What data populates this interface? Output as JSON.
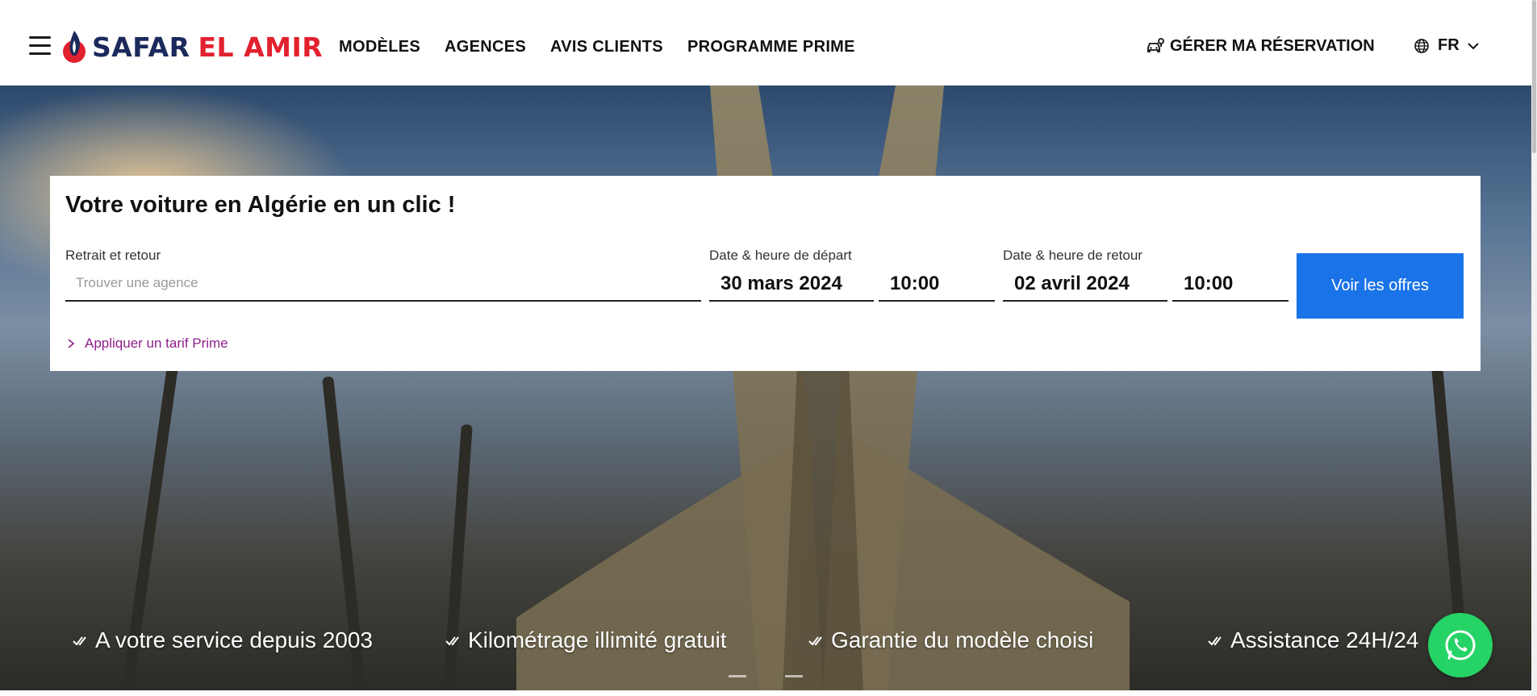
{
  "header": {
    "brand_part1": "SAFAR",
    "brand_part2": "EL AMIR",
    "nav": [
      "MODÈLES",
      "AGENCES",
      "AVIS CLIENTS",
      "PROGRAMME PRIME"
    ],
    "manage_label": "GÉRER MA RÉSERVATION",
    "lang_label": "FR",
    "icons": {
      "menu": "hamburger-icon",
      "logo": "flame-logo-icon",
      "manage": "car-key-icon",
      "lang": "globe-icon",
      "dropdown": "chevron-down-icon"
    }
  },
  "booking": {
    "title": "Votre voiture en Algérie en un clic !",
    "pickup_label": "Retrait et retour",
    "pickup_placeholder": "Trouver une agence",
    "depart_label": "Date & heure de départ",
    "depart_date": "30 mars 2024",
    "depart_time": "10:00",
    "return_label": "Date & heure de retour",
    "return_date": "02 avril 2024",
    "return_time": "10:00",
    "cta_label": "Voir les offres",
    "prime_link": "Appliquer un tarif Prime"
  },
  "features": [
    "A votre service depuis 2003",
    "Kilométrage illimité gratuit",
    "Garantie du modèle choisi",
    "Assistance 24H/24"
  ],
  "colors": {
    "brand_navy": "#1b2a5b",
    "brand_red": "#e2212f",
    "cta_blue": "#1a73e8",
    "prime_purple": "#8e1f8a",
    "whatsapp_green": "#25d366"
  }
}
